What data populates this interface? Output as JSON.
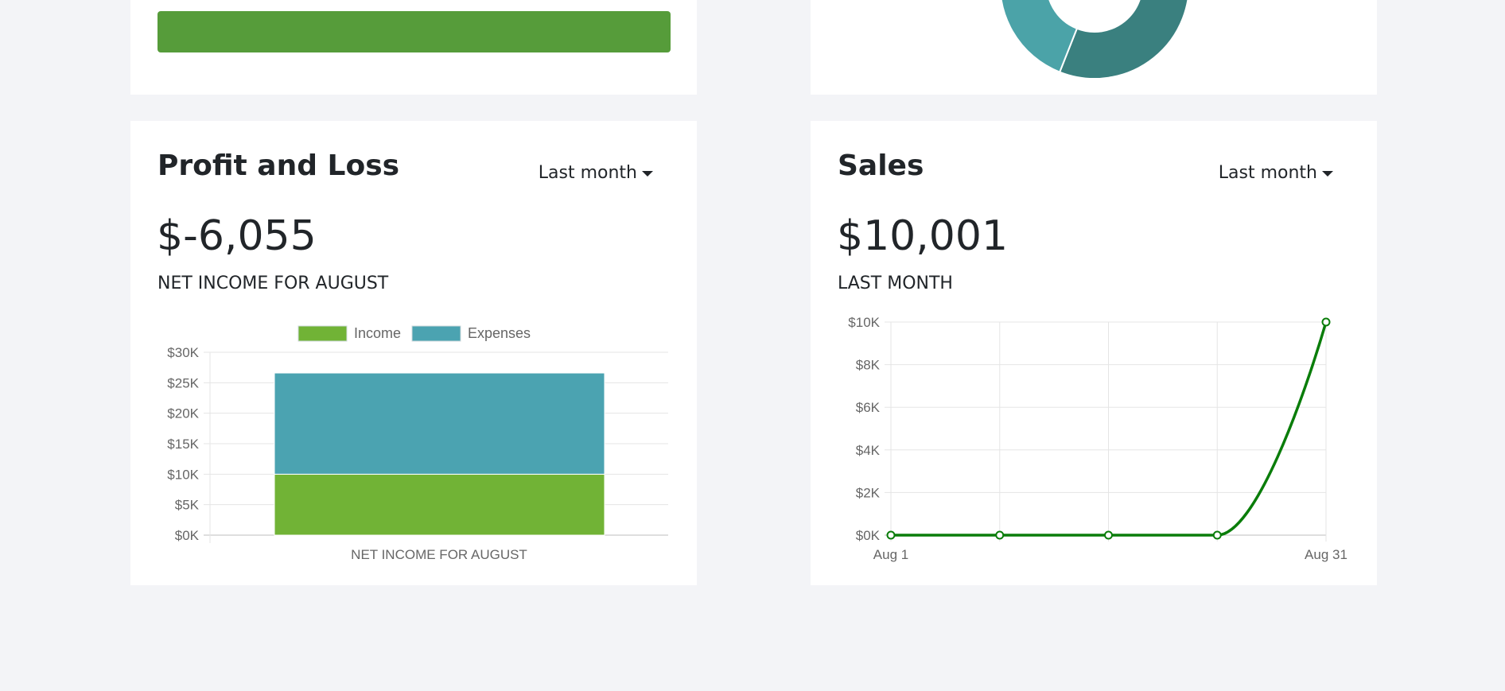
{
  "colors": {
    "income": "#71b336",
    "expenses": "#4ba3b1",
    "top_bar": "#569c3a",
    "donut_light": "#4ba3a8",
    "donut_dark": "#3a807f",
    "sales_line": "#0a7d0a"
  },
  "profit_loss": {
    "title": "Profit and Loss",
    "range": "Last month",
    "amount": "$-6,055",
    "subtitle": "NET INCOME FOR AUGUST"
  },
  "sales": {
    "title": "Sales",
    "range": "Last month",
    "amount": "$10,001",
    "subtitle": "LAST MONTH"
  },
  "chart_data": [
    {
      "type": "bar",
      "stacked": true,
      "categories": [
        "NET INCOME FOR AUGUST"
      ],
      "series": [
        {
          "name": "Income",
          "values": [
            10000
          ]
        },
        {
          "name": "Expenses",
          "values": [
            16600
          ]
        }
      ],
      "y_ticks": [
        "$0K",
        "$5K",
        "$10K",
        "$15K",
        "$20K",
        "$25K",
        "$30K"
      ],
      "ylim": [
        0,
        30000
      ],
      "legend": "top",
      "grid": true
    },
    {
      "type": "line",
      "x": [
        "Aug 1",
        "",
        "",
        "",
        "Aug 31"
      ],
      "series": [
        {
          "values": [
            0,
            0,
            0,
            0,
            10001
          ]
        }
      ],
      "y_ticks": [
        "$0K",
        "$2K",
        "$4K",
        "$6K",
        "$8K",
        "$10K"
      ],
      "ylim": [
        0,
        10000
      ],
      "grid": true
    }
  ]
}
